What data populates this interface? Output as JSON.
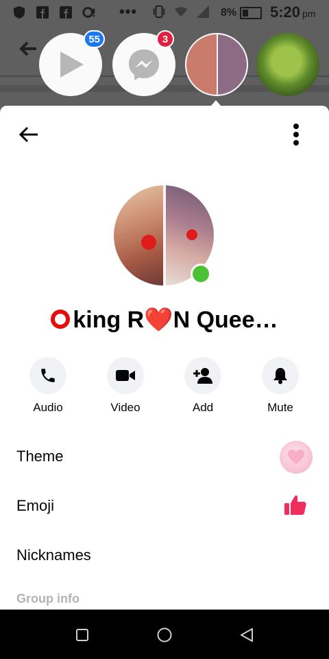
{
  "status_bar": {
    "battery_percent": "8%",
    "time": "5:20",
    "ampm": "pm",
    "overflow_dots": "•••"
  },
  "chat_heads": [
    {
      "name": "play-app",
      "badge": "55",
      "badge_color": "#1877f2"
    },
    {
      "name": "messenger-app",
      "badge": "3",
      "badge_color": "#e41e3f"
    },
    {
      "name": "user-avatar"
    },
    {
      "name": "nature-avatar"
    }
  ],
  "conversation": {
    "name_prefix": "king R",
    "name_heart": "❤️",
    "name_suffix": "N Quee…",
    "online": true,
    "online_color": "#4cc136"
  },
  "actions": [
    {
      "label": "Audio",
      "icon": "phone-icon"
    },
    {
      "label": "Video",
      "icon": "video-camera-icon"
    },
    {
      "label": "Add",
      "icon": "add-person-icon"
    },
    {
      "label": "Mute",
      "icon": "bell-icon"
    }
  ],
  "settings": {
    "theme_label": "Theme",
    "emoji_label": "Emoji",
    "emoji_value_icon": "thumbs-up-icon",
    "emoji_color": "#f02e5d",
    "nicknames_label": "Nicknames",
    "group_info_label": "Group info"
  },
  "colors": {
    "accent_blue": "#1877f2",
    "badge_red": "#e41e3f",
    "theme_pink": "#f8c4d6"
  }
}
